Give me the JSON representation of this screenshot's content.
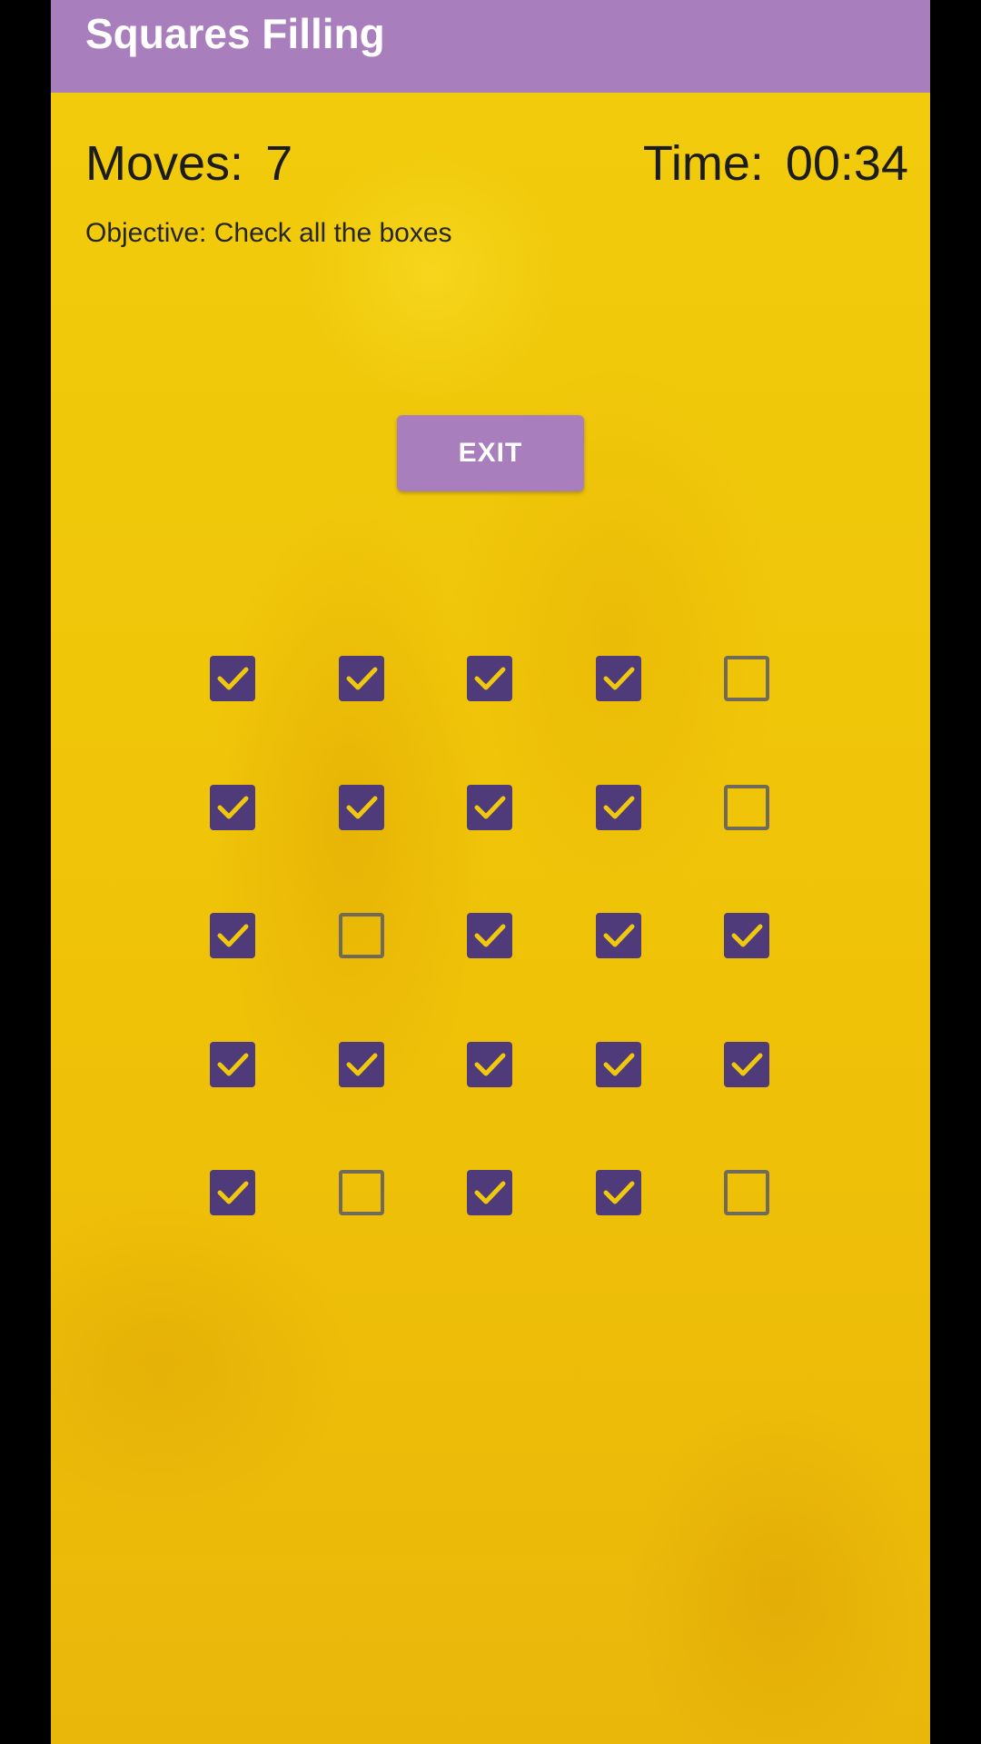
{
  "app": {
    "title": "Squares Filling"
  },
  "stats": {
    "moves_label": "Moves:",
    "moves_value": "7",
    "time_label": "Time:",
    "time_value": "00:34"
  },
  "objective": "Objective: Check all the boxes",
  "exit_label": "EXIT",
  "colors": {
    "app_bar": "#a97ebd",
    "checked_box": "#4f3a7a",
    "checkmark": "#f0c80c",
    "unchecked_border": "#6f6a5a",
    "background": "#f0c609"
  },
  "board": {
    "rows": 5,
    "cols": 5,
    "checked": [
      [
        true,
        true,
        true,
        true,
        false
      ],
      [
        true,
        true,
        true,
        true,
        false
      ],
      [
        true,
        false,
        true,
        true,
        true
      ],
      [
        true,
        true,
        true,
        true,
        true
      ],
      [
        true,
        false,
        true,
        true,
        false
      ]
    ]
  }
}
